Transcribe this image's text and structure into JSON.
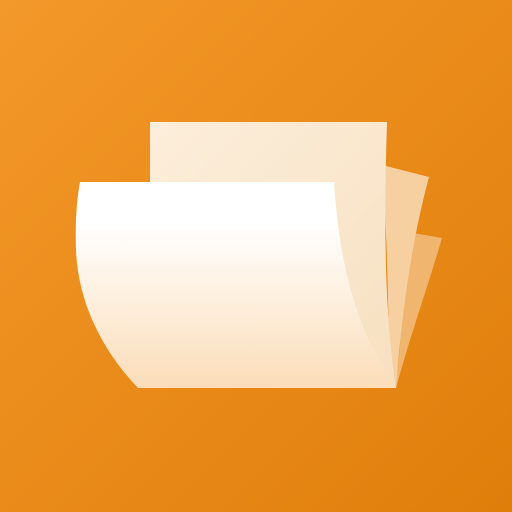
{
  "icon": {
    "name": "file-manager-folder-icon",
    "colors": {
      "background_start": "#F3982A",
      "background_end": "#E07E0A",
      "back_sheet_light": "#FCEEDB",
      "back_sheet_dark": "#F7E0C0",
      "middle_sheet": "#F6D0A0",
      "far_sheet": "#F0B56E",
      "front_sheet_top": "#FFFFFF",
      "front_sheet_bottom": "#FBDDB8"
    }
  }
}
